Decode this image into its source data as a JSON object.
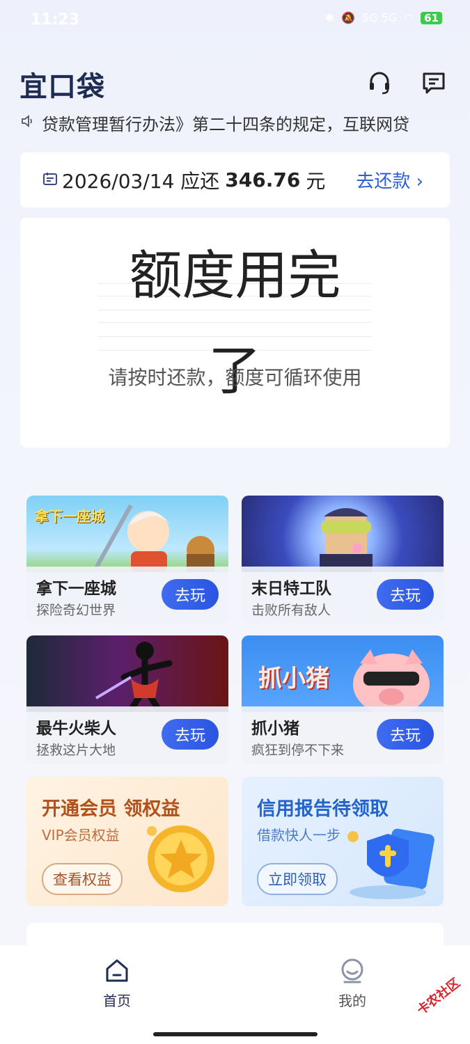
{
  "status_bar": {
    "time": "11:23",
    "signal": "5G 5G",
    "battery": "61"
  },
  "header": {
    "logo": "宜口袋",
    "support_icon": "headset-icon",
    "message_icon": "message-icon"
  },
  "notice": {
    "icon": "speaker-icon",
    "text": "贷款管理暂行办法》第二十四条的规定，互联网贷"
  },
  "repay": {
    "date": "2026/03/14 应还",
    "amount": "346.76",
    "unit": "元",
    "action": "去还款"
  },
  "quota": {
    "title_line1": "额度用完",
    "title_line2": "了",
    "subtitle": "请按时还款，额度可循环使用"
  },
  "games": [
    {
      "name": "拿下一座城",
      "desc": "探险奇幻世界",
      "button": "去玩",
      "art_title": "拿下一座城"
    },
    {
      "name": "末日特工队",
      "desc": "击败所有敌人",
      "button": "去玩"
    },
    {
      "name": "最牛火柴人",
      "desc": "拯救这片大地",
      "button": "去玩"
    },
    {
      "name": "抓小猪",
      "desc": "疯狂到停不下来",
      "button": "去玩",
      "art_title": "抓小猪"
    }
  ],
  "promos": [
    {
      "title": "开通会员 领权益",
      "desc": "VIP会员权益",
      "button": "查看权益"
    },
    {
      "title": "信用报告待领取",
      "desc": "借款快人一步",
      "button": "立即领取"
    }
  ],
  "nav": [
    {
      "label": "首页",
      "icon": "home-icon",
      "active": true
    },
    {
      "label": "我的",
      "icon": "profile-icon",
      "active": false
    }
  ],
  "watermark": "卡农社区",
  "colors": {
    "accent": "#2f5fd8",
    "logo": "#1e2b52",
    "gold_title": "#b2501c",
    "blue_title": "#2463c9"
  }
}
